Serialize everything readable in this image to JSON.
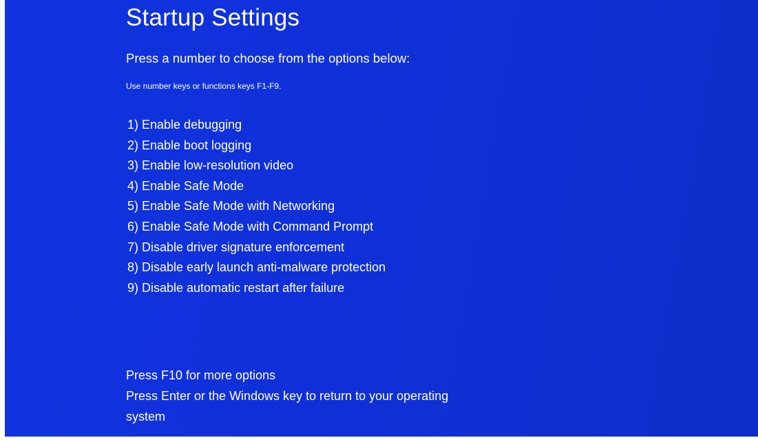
{
  "screen": {
    "title": "Startup Settings",
    "subtitle": "Press a number to choose from the options below:",
    "hint": "Use number keys or functions keys F1-F9.",
    "background_color": "#1030dc"
  },
  "options": [
    {
      "label": "1) Enable debugging"
    },
    {
      "label": "2) Enable boot logging"
    },
    {
      "label": "3) Enable low-resolution video"
    },
    {
      "label": "4) Enable Safe Mode"
    },
    {
      "label": "5) Enable Safe Mode with Networking"
    },
    {
      "label": "6) Enable Safe Mode with Command Prompt"
    },
    {
      "label": "7) Disable driver signature enforcement"
    },
    {
      "label": "8) Disable early launch anti-malware protection"
    },
    {
      "label": "9) Disable automatic restart after failure"
    }
  ],
  "footer": {
    "more_options": "Press F10 for more options",
    "return_line1": "Press Enter or the Windows key to return to your operating",
    "return_line2": "system"
  }
}
